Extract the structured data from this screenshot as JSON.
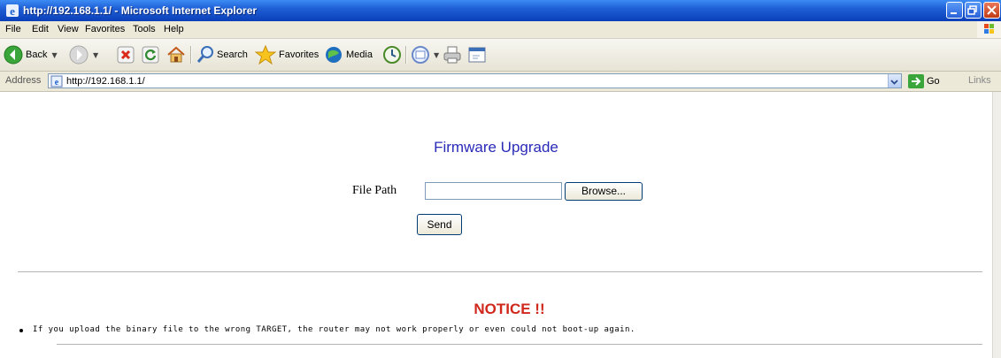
{
  "window": {
    "title": "http://192.168.1.1/ - Microsoft Internet Explorer"
  },
  "menu": [
    "File",
    "Edit",
    "View",
    "Favorites",
    "Tools",
    "Help"
  ],
  "toolbar": {
    "back_label": "Back",
    "search_label": "Search",
    "favorites_label": "Favorites",
    "media_label": "Media"
  },
  "address": {
    "label": "Address",
    "url": "http://192.168.1.1/",
    "go_label": "Go",
    "links_label": "Links"
  },
  "page": {
    "title": "Firmware Upgrade",
    "file_path_label": "File Path",
    "file_path_value": "",
    "browse_label": "Browse...",
    "send_label": "Send",
    "notice_title": "NOTICE !!",
    "notice_text": "If you upload the binary file to the wrong TARGET, the router may not work properly or even could not boot-up again."
  },
  "colors": {
    "titlebar": "#1f5fd6",
    "page_title": "#2a2ab8",
    "notice": "#d0281c"
  },
  "icons": [
    "ie-icon",
    "minimize-icon",
    "maximize-icon",
    "close-icon",
    "windows-flag-icon",
    "back-icon",
    "forward-icon",
    "stop-icon",
    "refresh-icon",
    "home-icon",
    "search-icon",
    "favorites-star-icon",
    "media-icon",
    "history-icon",
    "mail-icon",
    "print-icon",
    "edit-icon",
    "page-icon",
    "go-arrow-icon"
  ]
}
